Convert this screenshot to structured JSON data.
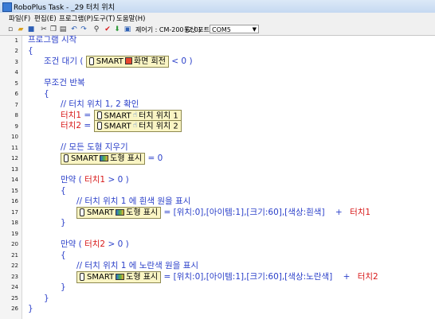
{
  "window": {
    "title": "RoboPlus Task - _29 터치 위치"
  },
  "menu": [
    "파일(F)",
    "편집(E)",
    "프로그램(P)",
    "도구(T)",
    "도움말(H)"
  ],
  "toolbar": {
    "controller_label": "제어기 : CM-200 (2.0)",
    "port_label": "통신 포트 :",
    "port_value": "COM5"
  },
  "line_numbers": [
    "1",
    "2",
    "3",
    "4",
    "5",
    "6",
    "7",
    "8",
    "9",
    "10",
    "11",
    "12",
    "13",
    "14",
    "15",
    "16",
    "17",
    "18",
    "19",
    "20",
    "21",
    "22",
    "23",
    "24",
    "25",
    "26"
  ],
  "code": {
    "l1": "프로그램 시작",
    "l2": "{",
    "l3_kw": "조건 대기 (",
    "l3_blk_a": "SMART",
    "l3_blk_b": "화면 회전",
    "l3_op": "<",
    "l3_val": "0",
    "l3_end": ")",
    "l5": "무조건 반복",
    "l6": "{",
    "l7": "// 터치 위치 1, 2 확인",
    "l8_var": "터치1",
    "l8_eq": "=",
    "l8_blk_a": "SMART",
    "l8_blk_b": "터치 위치 1",
    "l9_var": "터치2",
    "l9_eq": "=",
    "l9_blk_a": "SMART",
    "l9_blk_b": "터치 위치 2",
    "l11": "// 모든 도형 지우기",
    "l12_blk_a": "SMART",
    "l12_blk_b": "도형 표시",
    "l12_eq": "=",
    "l12_val": "0",
    "l14_kw": "만약 (",
    "l14_var": "터치1",
    "l14_op": ">",
    "l14_val": "0",
    "l14_end": ")",
    "l15": "{",
    "l16": "// 터치 위치 1 에 흰색 원을 표시",
    "l17_blk_a": "SMART",
    "l17_blk_b": "도형 표시",
    "l17_eq": "=",
    "l17_val": "[위치:0],[아이템:1],[크기:60],[색상:흰색]",
    "l17_plus": "+",
    "l17_var": "터치1",
    "l18": "}",
    "l20_kw": "만약 (",
    "l20_var": "터치2",
    "l20_op": ">",
    "l20_val": "0",
    "l20_end": ")",
    "l21": "{",
    "l22": "// 터치 위치 1 에 노란색 원을 표시",
    "l23_blk_a": "SMART",
    "l23_blk_b": "도형 표시",
    "l23_eq": "=",
    "l23_val": "[위치:0],[아이템:1],[크기:60],[색상:노란색]",
    "l23_plus": "+",
    "l23_var": "터치2",
    "l24": "}",
    "l25": "}",
    "l26": "}"
  }
}
